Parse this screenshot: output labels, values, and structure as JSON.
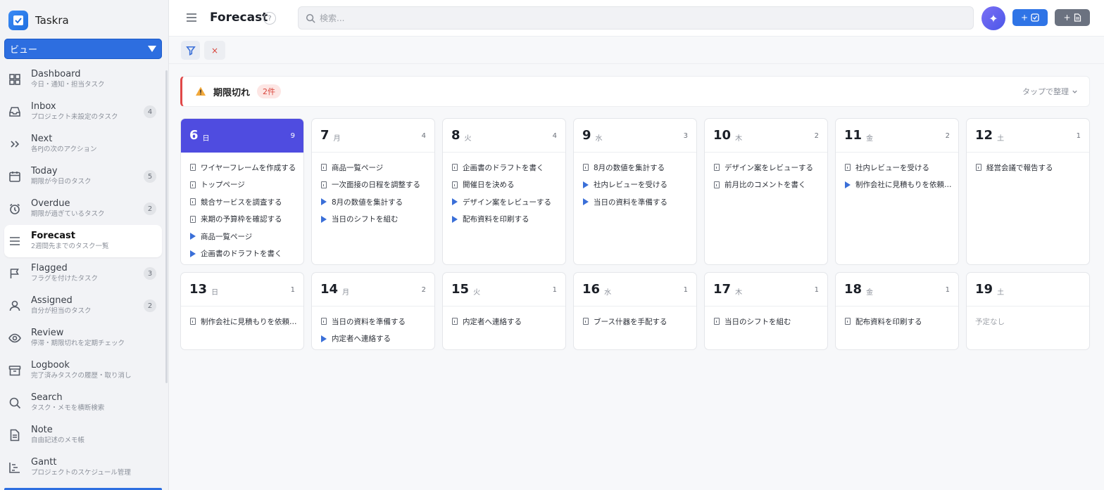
{
  "app": {
    "name": "Taskra"
  },
  "view_select": {
    "label": "ビュー"
  },
  "nav": [
    {
      "id": "dashboard",
      "label": "Dashboard",
      "sub": "今日・通知・担当タスク",
      "icon": "grid-icon",
      "count": null
    },
    {
      "id": "inbox",
      "label": "Inbox",
      "sub": "プロジェクト未設定のタスク",
      "icon": "inbox-icon",
      "count": "4"
    },
    {
      "id": "next",
      "label": "Next",
      "sub": "各PJの次のアクション",
      "icon": "chevrons-right-icon",
      "count": null
    },
    {
      "id": "today",
      "label": "Today",
      "sub": "期限が今日のタスク",
      "icon": "calendar-icon",
      "count": "5"
    },
    {
      "id": "overdue",
      "label": "Overdue",
      "sub": "期限が過ぎているタスク",
      "icon": "alarm-icon",
      "count": "2"
    },
    {
      "id": "forecast",
      "label": "Forecast",
      "sub": "2週間先までのタスク一覧",
      "icon": "list-icon",
      "count": null,
      "active": true
    },
    {
      "id": "flagged",
      "label": "Flagged",
      "sub": "フラグを付けたタスク",
      "icon": "flag-icon",
      "count": "3"
    },
    {
      "id": "assigned",
      "label": "Assigned",
      "sub": "自分が担当のタスク",
      "icon": "user-icon",
      "count": "2"
    },
    {
      "id": "review",
      "label": "Review",
      "sub": "停滞・期限切れを定期チェック",
      "icon": "eye-icon",
      "count": null
    },
    {
      "id": "logbook",
      "label": "Logbook",
      "sub": "完了済みタスクの履歴・取り消し",
      "icon": "archive-icon",
      "count": null
    },
    {
      "id": "search",
      "label": "Search",
      "sub": "タスク・メモを横断検索",
      "icon": "search-icon",
      "count": null
    },
    {
      "id": "note",
      "label": "Note",
      "sub": "自由記述のメモ帳",
      "icon": "note-icon",
      "count": null
    },
    {
      "id": "gantt",
      "label": "Gantt",
      "sub": "プロジェクトのスケジュール管理",
      "icon": "gantt-icon",
      "count": null
    }
  ],
  "header": {
    "title": "Forecast",
    "help": "?",
    "search_placeholder": "検索...",
    "add_task_label": "+",
    "add_note_label": "+"
  },
  "filter": {
    "clear_label": "×"
  },
  "overdue": {
    "title": "期限切れ",
    "badge": "2件",
    "action": "タップで整理"
  },
  "days": [
    {
      "num": "6",
      "wd": "日",
      "count": "9",
      "today": true,
      "tasks": [
        {
          "t": "doc",
          "text": "ワイヤーフレームを作成する"
        },
        {
          "t": "doc",
          "text": "トップページ"
        },
        {
          "t": "doc",
          "text": "競合サービスを調査する"
        },
        {
          "t": "doc",
          "text": "来期の予算枠を確認する"
        },
        {
          "t": "play",
          "text": "商品一覧ページ"
        },
        {
          "t": "play",
          "text": "企画書のドラフトを書く"
        }
      ]
    },
    {
      "num": "7",
      "wd": "月",
      "count": "4",
      "tasks": [
        {
          "t": "doc",
          "text": "商品一覧ページ"
        },
        {
          "t": "doc",
          "text": "一次面接の日程を調整する"
        },
        {
          "t": "play",
          "text": "8月の数値を集計する"
        },
        {
          "t": "play",
          "text": "当日のシフトを組む"
        }
      ]
    },
    {
      "num": "8",
      "wd": "火",
      "count": "4",
      "tasks": [
        {
          "t": "doc",
          "text": "企画書のドラフトを書く"
        },
        {
          "t": "doc",
          "text": "開催日を決める"
        },
        {
          "t": "play",
          "text": "デザイン案をレビューする"
        },
        {
          "t": "play",
          "text": "配布資料を印刷する"
        }
      ]
    },
    {
      "num": "9",
      "wd": "水",
      "count": "3",
      "tasks": [
        {
          "t": "doc",
          "text": "8月の数値を集計する"
        },
        {
          "t": "play",
          "text": "社内レビューを受ける"
        },
        {
          "t": "play",
          "text": "当日の資料を準備する"
        }
      ]
    },
    {
      "num": "10",
      "wd": "木",
      "count": "2",
      "tasks": [
        {
          "t": "doc",
          "text": "デザイン案をレビューする"
        },
        {
          "t": "doc",
          "text": "前月比のコメントを書く"
        }
      ]
    },
    {
      "num": "11",
      "wd": "金",
      "count": "2",
      "tasks": [
        {
          "t": "doc",
          "text": "社内レビューを受ける"
        },
        {
          "t": "play",
          "text": "制作会社に見積もりを依頼す..."
        }
      ]
    },
    {
      "num": "12",
      "wd": "土",
      "count": "1",
      "tasks": [
        {
          "t": "doc",
          "text": "経営会議で報告する"
        }
      ]
    },
    {
      "num": "13",
      "wd": "日",
      "count": "1",
      "tasks": [
        {
          "t": "doc",
          "text": "制作会社に見積もりを依頼す..."
        }
      ]
    },
    {
      "num": "14",
      "wd": "月",
      "count": "2",
      "tasks": [
        {
          "t": "doc",
          "text": "当日の資料を準備する"
        },
        {
          "t": "play",
          "text": "内定者へ連絡する"
        }
      ]
    },
    {
      "num": "15",
      "wd": "火",
      "count": "1",
      "tasks": [
        {
          "t": "doc",
          "text": "内定者へ連絡する"
        }
      ]
    },
    {
      "num": "16",
      "wd": "水",
      "count": "1",
      "tasks": [
        {
          "t": "doc",
          "text": "ブース什器を手配する"
        }
      ]
    },
    {
      "num": "17",
      "wd": "木",
      "count": "1",
      "tasks": [
        {
          "t": "doc",
          "text": "当日のシフトを組む"
        }
      ]
    },
    {
      "num": "18",
      "wd": "金",
      "count": "1",
      "tasks": [
        {
          "t": "doc",
          "text": "配布資料を印刷する"
        }
      ]
    },
    {
      "num": "19",
      "wd": "土",
      "count": "",
      "empty": "予定なし",
      "tasks": []
    }
  ],
  "colors": {
    "accent": "#2f74e6",
    "today": "#4f4ce0",
    "danger": "#e04848"
  }
}
